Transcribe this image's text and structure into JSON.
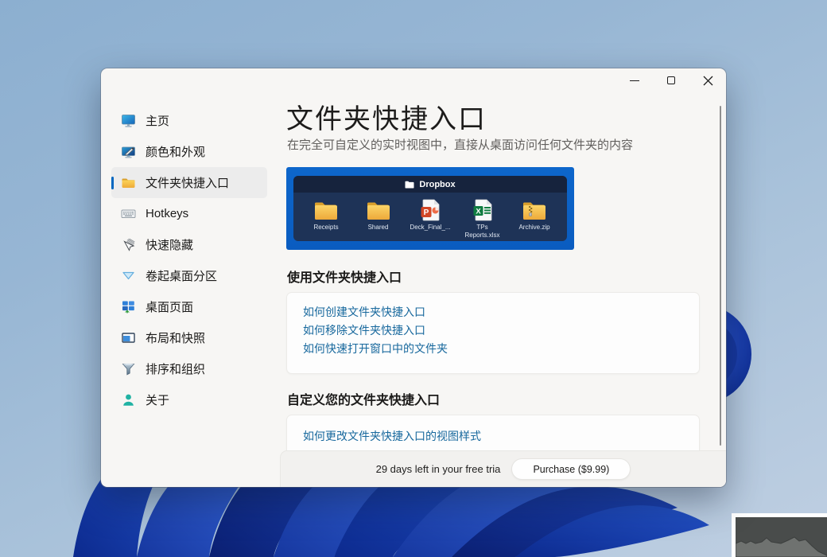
{
  "window": {
    "controls": {
      "minimize_icon": "minimize",
      "maximize_icon": "maximize",
      "close_icon": "close"
    },
    "sidebar": {
      "items": [
        {
          "label": "主页",
          "icon": "monitor-icon",
          "selected": false
        },
        {
          "label": "颜色和外观",
          "icon": "appearance-icon",
          "selected": false
        },
        {
          "label": "文件夹快捷入口",
          "icon": "folder-icon",
          "selected": true
        },
        {
          "label": "Hotkeys",
          "icon": "keyboard-icon",
          "selected": false
        },
        {
          "label": "快速隐藏",
          "icon": "cursor-hide-icon",
          "selected": false
        },
        {
          "label": "卷起桌面分区",
          "icon": "rollup-triangle-icon",
          "selected": false
        },
        {
          "label": "桌面页面",
          "icon": "desktop-pages-icon",
          "selected": false
        },
        {
          "label": "布局和快照",
          "icon": "layout-window-icon",
          "selected": false
        },
        {
          "label": "排序和组织",
          "icon": "sort-funnel-icon",
          "selected": false
        },
        {
          "label": "关于",
          "icon": "person-icon",
          "selected": false
        }
      ]
    },
    "content": {
      "title": "文件夹快捷入口",
      "subtitle": "在完全可自定义的实时视图中，直接从桌面访问任何文件夹的内容",
      "preview": {
        "panel_title": "Dropbox",
        "panel_title_icon": "white-folder-icon",
        "items": [
          {
            "label": "Receipts",
            "type": "folder"
          },
          {
            "label": "Shared",
            "type": "folder"
          },
          {
            "label": "Deck_Final_...",
            "type": "powerpoint"
          },
          {
            "label": "TPs Reports.xlsx",
            "type": "excel"
          },
          {
            "label": "Archive.zip",
            "type": "zip"
          }
        ]
      },
      "sections": [
        {
          "heading": "使用文件夹快捷入口",
          "links": [
            "如何创建文件夹快捷入口",
            "如何移除文件夹快捷入口",
            "如何快速打开窗口中的文件夹"
          ]
        },
        {
          "heading": "自定义您的文件夹快捷入口",
          "links": [
            "如何更改文件夹快捷入口的视图样式"
          ]
        }
      ]
    },
    "trial_bar": {
      "message": "29 days left in your free tria",
      "purchase_label": "Purchase ($9.99)"
    }
  },
  "colors": {
    "accent": "#0067c0",
    "link": "#17689d",
    "preview_background": "#0d66cb",
    "preview_panel": "#1e3357",
    "preview_panel_header": "#16233d",
    "window_background": "#f7f6f4"
  }
}
